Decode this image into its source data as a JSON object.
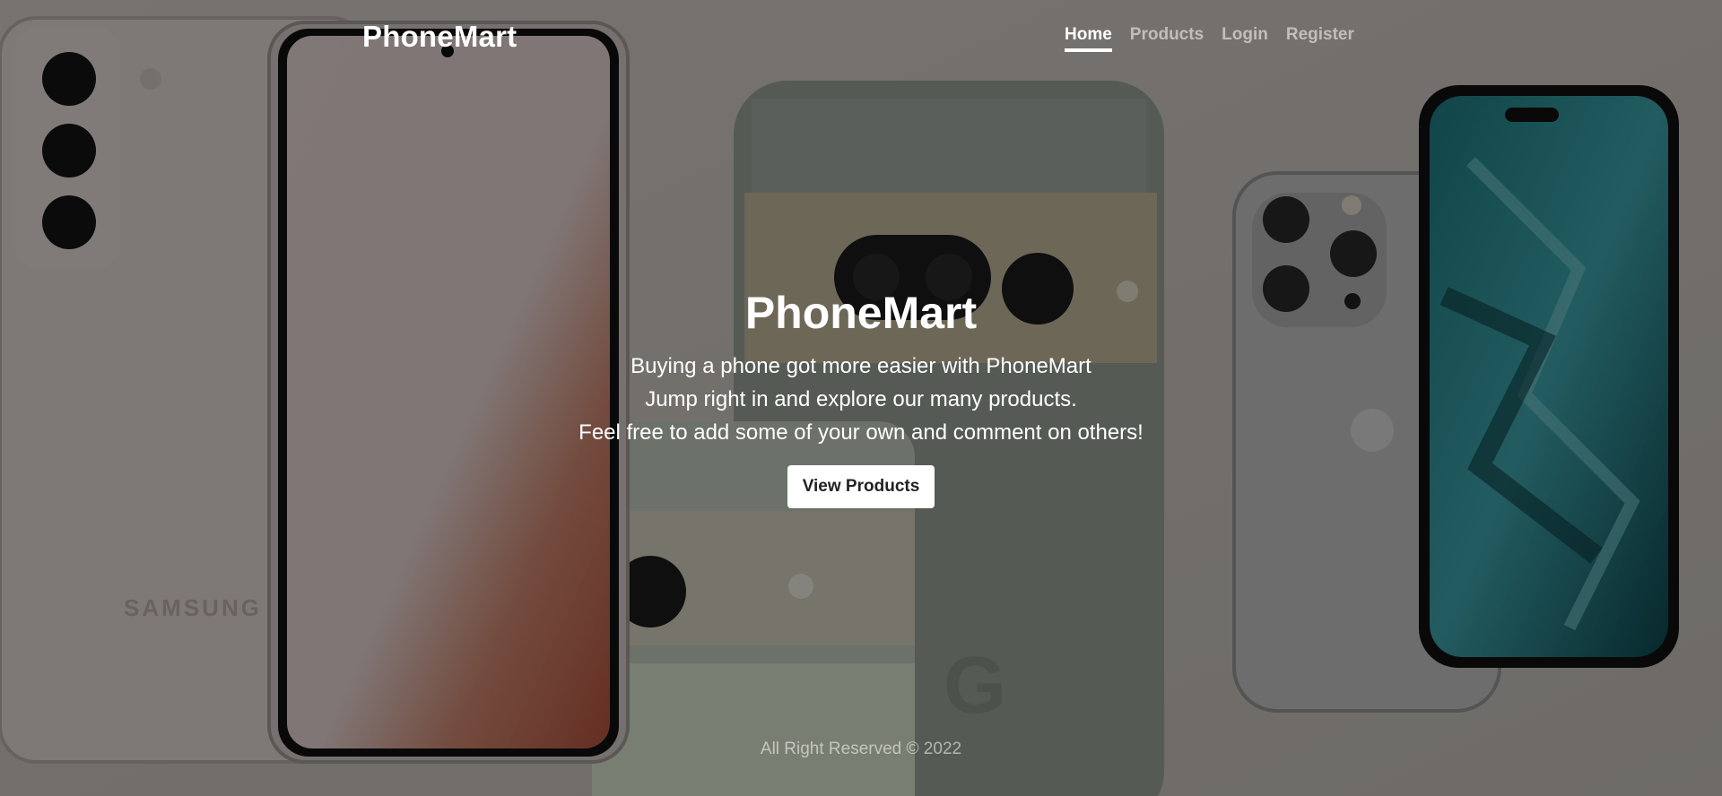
{
  "header": {
    "brand": "PhoneMart",
    "nav": [
      {
        "label": "Home",
        "active": true
      },
      {
        "label": "Products",
        "active": false
      },
      {
        "label": "Login",
        "active": false
      },
      {
        "label": "Register",
        "active": false
      }
    ]
  },
  "hero": {
    "title": "PhoneMart",
    "lines": [
      "Buying a phone got more easier with PhoneMart",
      "Jump right in and explore our many products.",
      "Feel free to add some of your own and comment on others!"
    ],
    "button_label": "View Products"
  },
  "background": {
    "phones": [
      {
        "name": "samsung-phone",
        "brand_mark": "SAMSUNG"
      },
      {
        "name": "google-pixel-phone",
        "brand_mark": "G"
      },
      {
        "name": "iphone"
      }
    ]
  },
  "footer": {
    "text": "All Right Reserved © 2022"
  }
}
